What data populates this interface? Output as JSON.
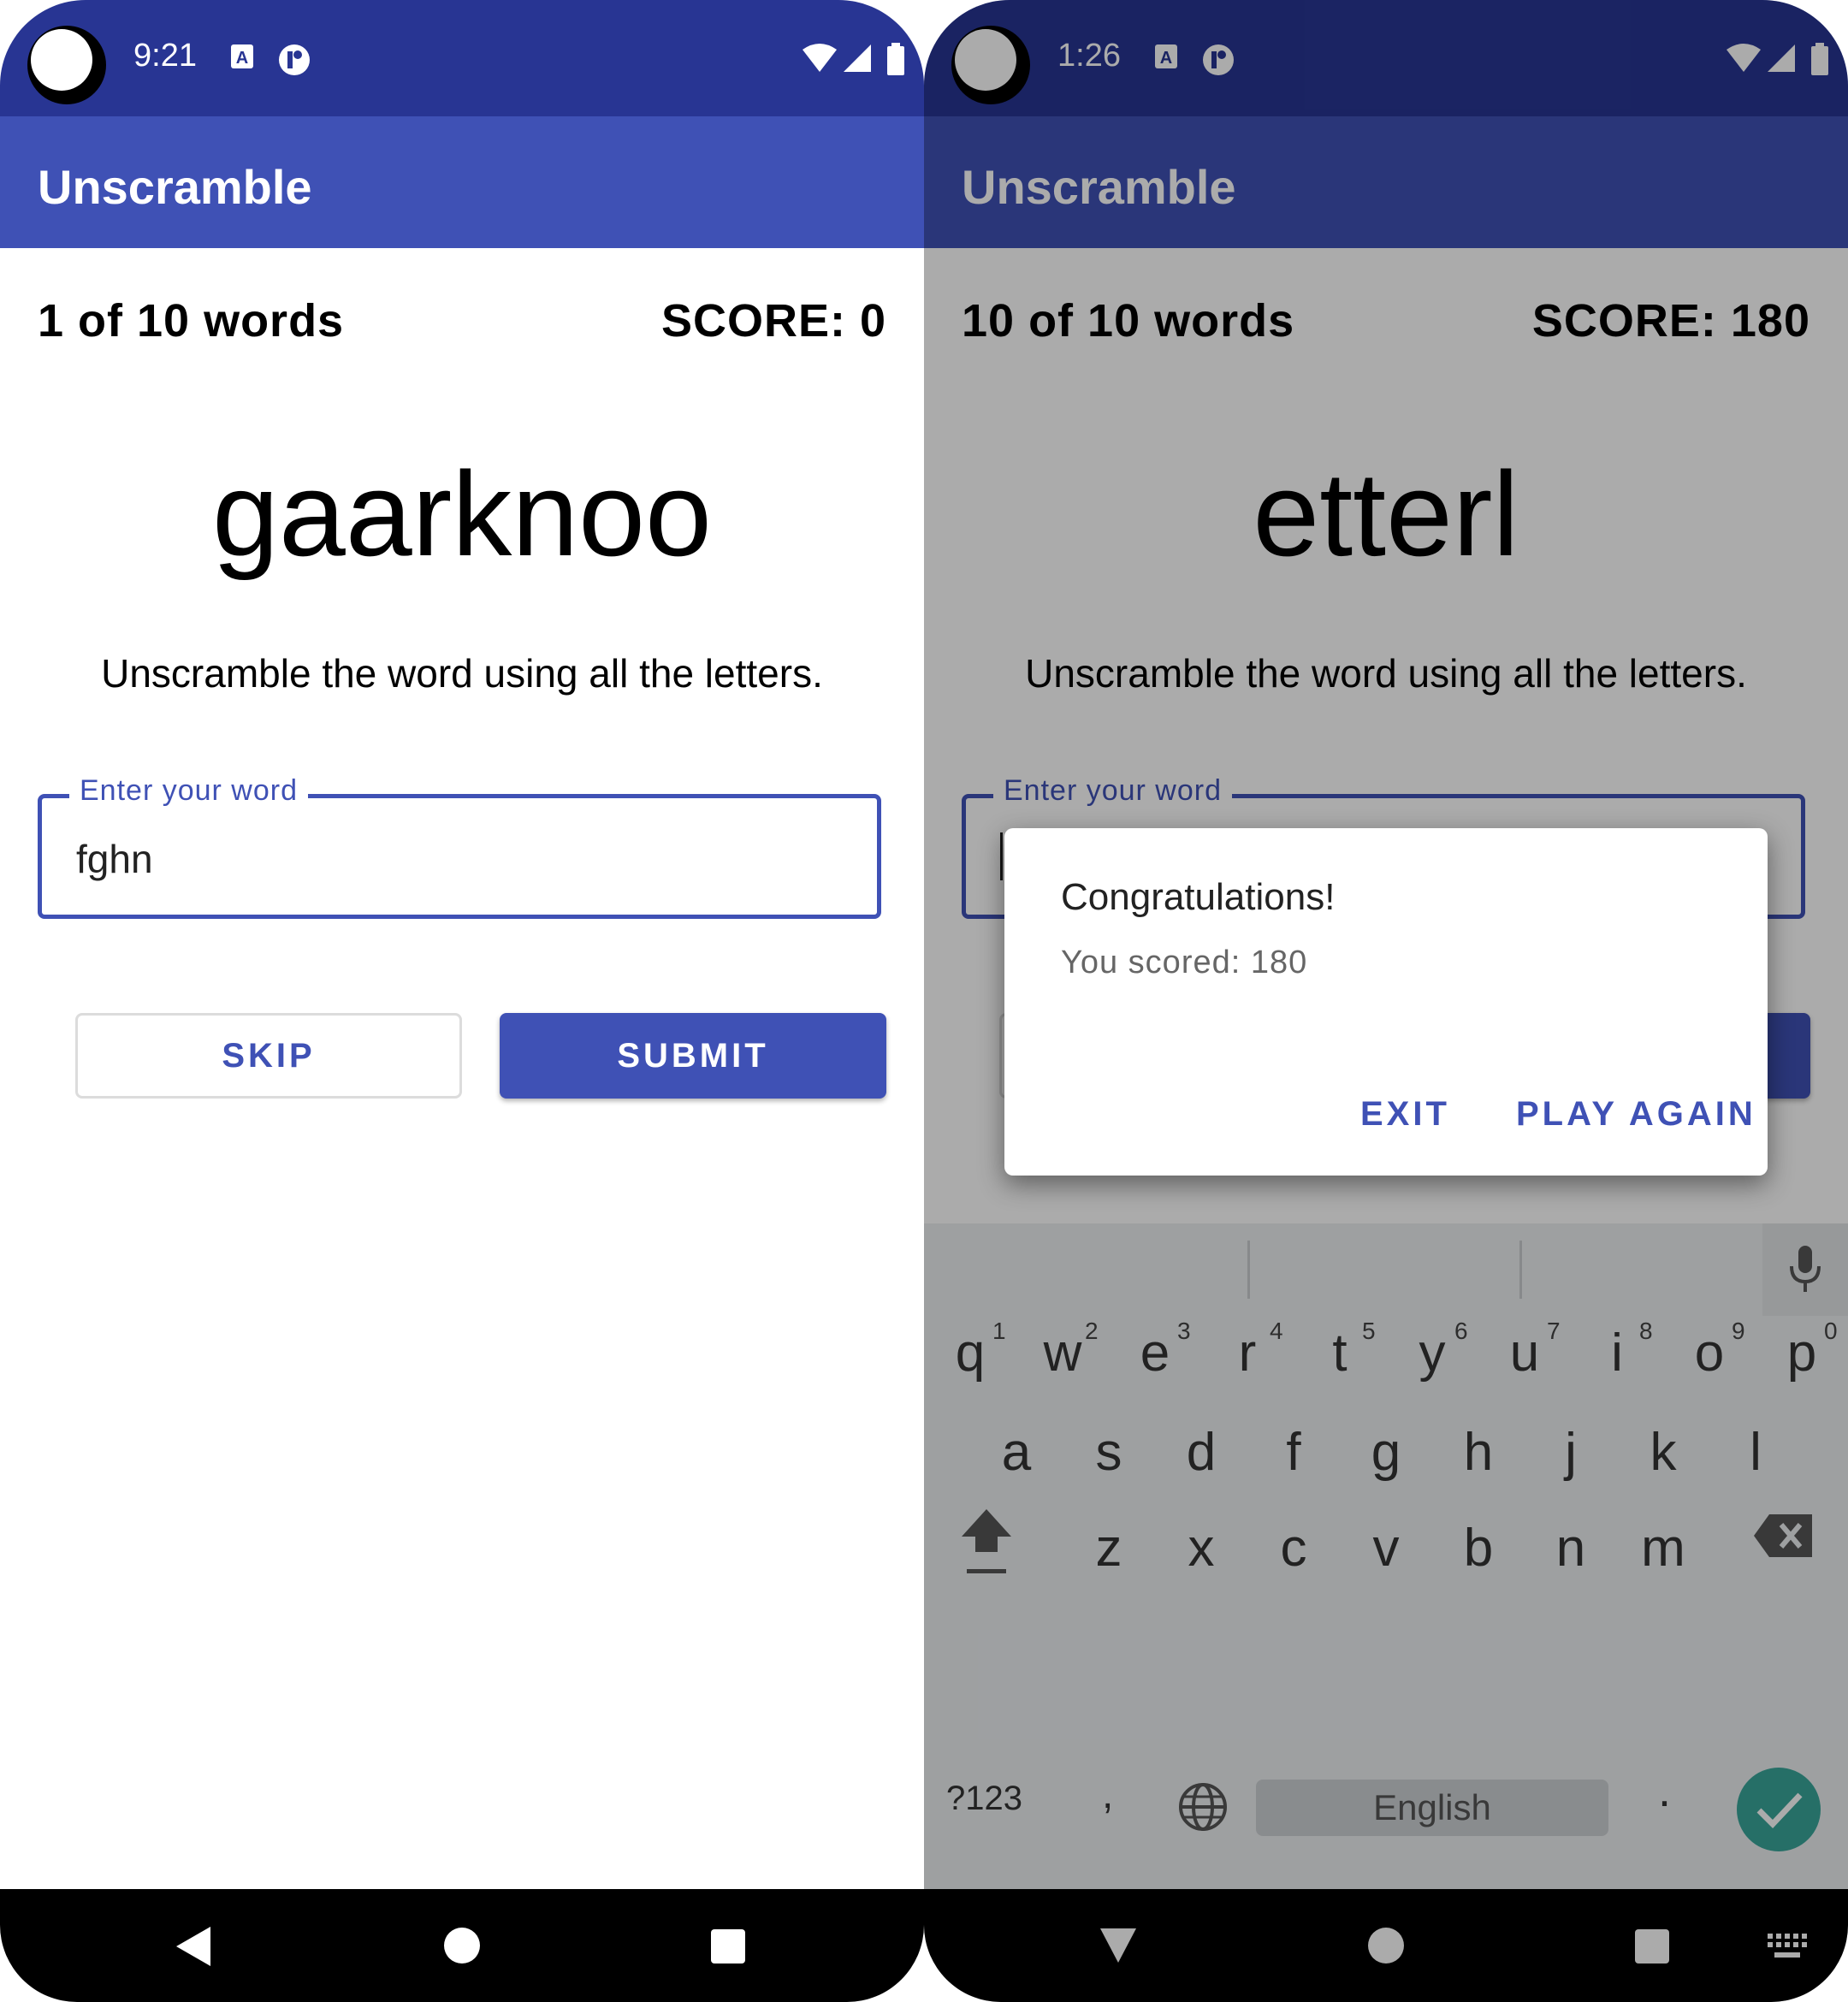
{
  "colors": {
    "primary": "#3f51b5",
    "primary_dark": "#283593",
    "enter_key": "#3aa69a"
  },
  "left": {
    "status": {
      "time": "9:21"
    },
    "app_title": "Unscramble",
    "word_count": "1 of 10 words",
    "score": "SCORE: 0",
    "scrambled_word": "gaarknoo",
    "instructions": "Unscramble the word using all the letters.",
    "input": {
      "label": "Enter your word",
      "value": "fghn"
    },
    "skip_label": "SKIP",
    "submit_label": "SUBMIT"
  },
  "right": {
    "status": {
      "time": "1:26"
    },
    "app_title": "Unscramble",
    "word_count": "10 of 10 words",
    "score": "SCORE: 180",
    "scrambled_word": "etterl",
    "instructions": "Unscramble the word using all the letters.",
    "input": {
      "label": "Enter your word",
      "value": ""
    },
    "dialog": {
      "title": "Congratulations!",
      "message": "You scored: 180",
      "exit_label": "EXIT",
      "play_again_label": "PLAY AGAIN"
    },
    "keyboard": {
      "row1": [
        "q",
        "w",
        "e",
        "r",
        "t",
        "y",
        "u",
        "i",
        "o",
        "p"
      ],
      "row1_hints": [
        "1",
        "2",
        "3",
        "4",
        "5",
        "6",
        "7",
        "8",
        "9",
        "0"
      ],
      "row2": [
        "a",
        "s",
        "d",
        "f",
        "g",
        "h",
        "j",
        "k",
        "l"
      ],
      "row3": [
        "z",
        "x",
        "c",
        "v",
        "b",
        "n",
        "m"
      ],
      "symbols_label": "?123",
      "comma": ",",
      "period": ".",
      "space_label": "English"
    }
  }
}
